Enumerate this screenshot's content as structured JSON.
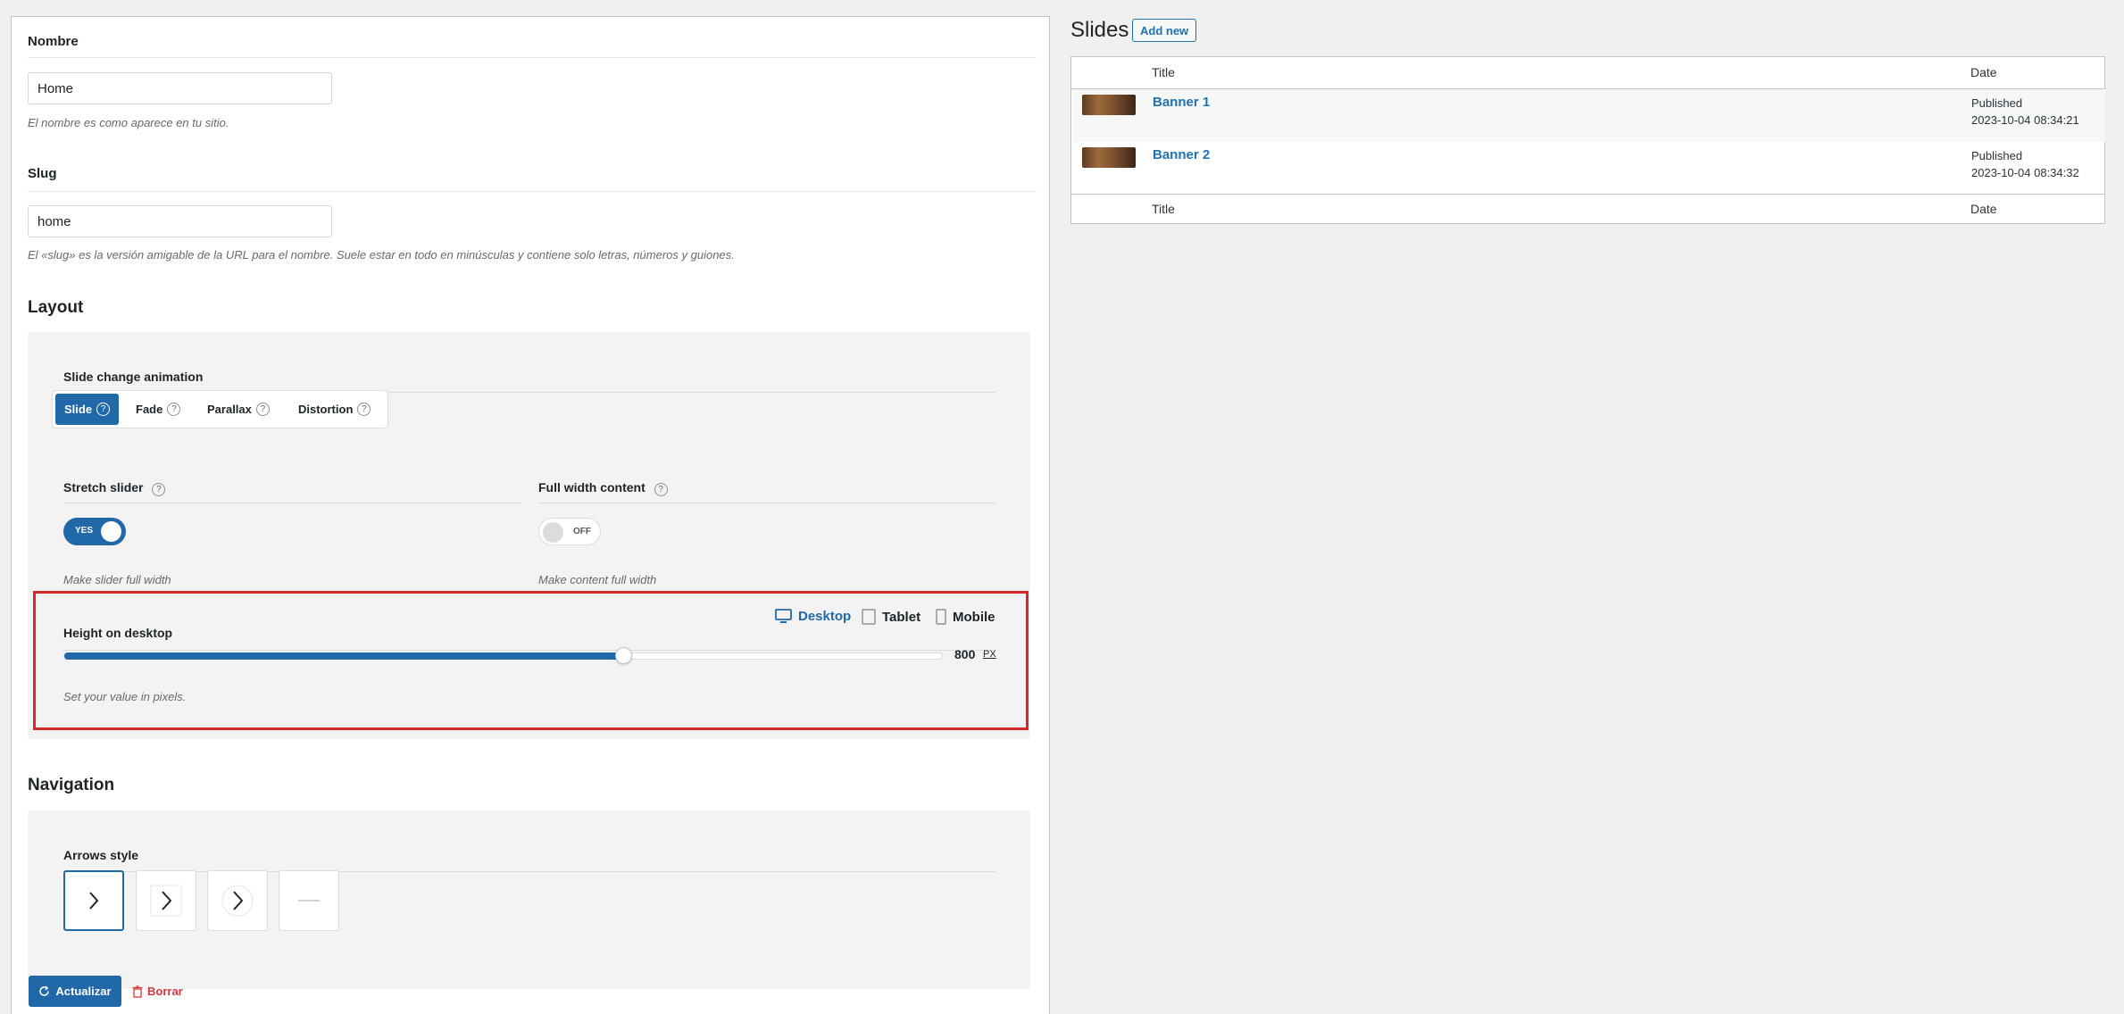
{
  "form": {
    "name_label": "Nombre",
    "name_value": "Home",
    "name_help": "El nombre es como aparece en tu sitio.",
    "slug_label": "Slug",
    "slug_value": "home",
    "slug_help": "El «slug» es la versión amigable de la URL para el nombre. Suele estar en todo en minúsculas y contiene solo letras, números y guiones."
  },
  "layout": {
    "title": "Layout",
    "animation_label": "Slide change animation",
    "animations": [
      {
        "label": "Slide",
        "active": true
      },
      {
        "label": "Fade",
        "active": false
      },
      {
        "label": "Parallax",
        "active": false
      },
      {
        "label": "Distortion",
        "active": false
      }
    ],
    "help_glyph": "?",
    "stretch_label": "Stretch slider",
    "stretch_state": "YES",
    "stretch_help": "Make slider full width",
    "fullwidth_label": "Full width content",
    "fullwidth_state": "OFF",
    "fullwidth_help": "Make content full width",
    "height_label": "Height on desktop",
    "devices": [
      "Desktop",
      "Tablet",
      "Mobile"
    ],
    "height_value": "800",
    "height_unit": "PX",
    "height_fraction": 0.636,
    "height_help": "Set your value in pixels."
  },
  "navigation": {
    "title": "Navigation",
    "arrows_label": "Arrows style",
    "arrow_styles": [
      "chevron-plain",
      "chevron-square",
      "chevron-circle",
      "dash"
    ]
  },
  "actions": {
    "update_label": "Actualizar",
    "delete_label": "Borrar"
  },
  "slides": {
    "title": "Slides",
    "add_new_label": "Add new",
    "col_title": "Title",
    "col_date": "Date",
    "rows": [
      {
        "title": "Banner 1",
        "status": "Published",
        "date": "2023-10-04 08:34:21"
      },
      {
        "title": "Banner 2",
        "status": "Published",
        "date": "2023-10-04 08:34:32"
      }
    ]
  },
  "colors": {
    "accent": "#2168a9",
    "danger": "#d63638",
    "highlight": "#d62828"
  }
}
